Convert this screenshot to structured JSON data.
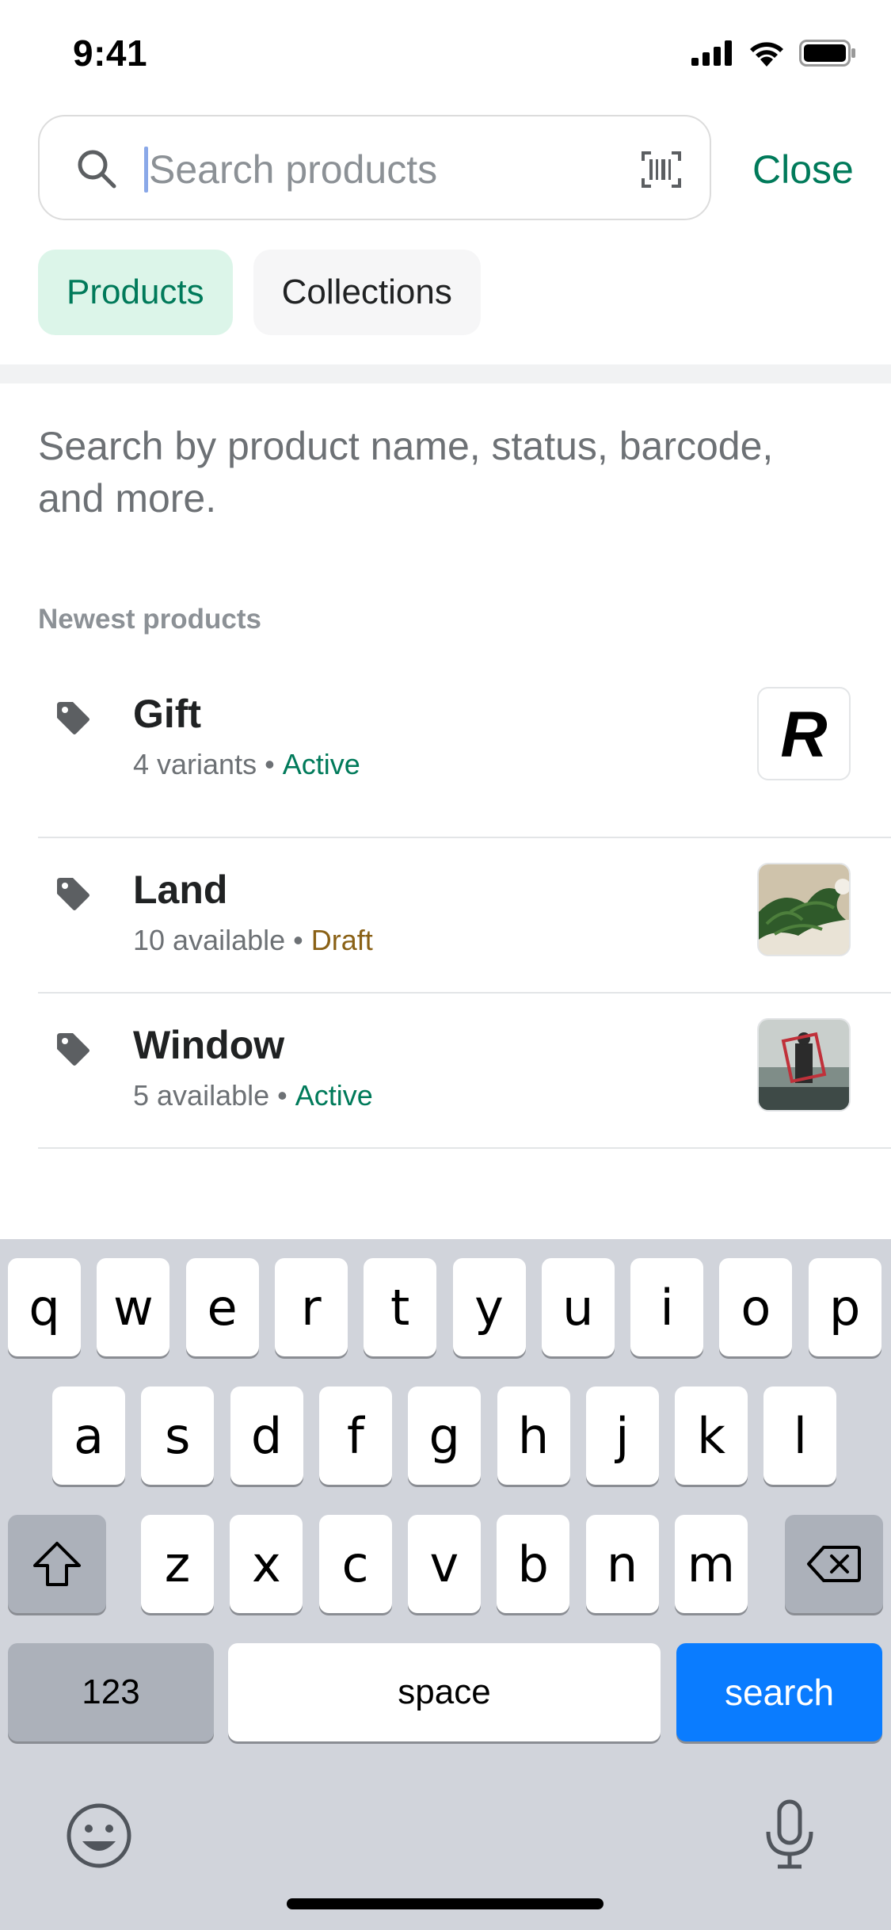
{
  "status_bar": {
    "time": "9:41"
  },
  "search": {
    "placeholder": "Search products",
    "value": "",
    "close_label": "Close"
  },
  "tabs": [
    {
      "label": "Products",
      "selected": true
    },
    {
      "label": "Collections",
      "selected": false
    }
  ],
  "hint_text": "Search by product name, status, barcode, and more.",
  "section_title": "Newest products",
  "products": [
    {
      "name": "Gift",
      "meta": "4 variants",
      "status": "Active",
      "status_color": "#007a5a",
      "thumbnail": "R"
    },
    {
      "name": "Land",
      "meta": "10 available",
      "status": "Draft",
      "status_color": "#8a6116",
      "thumbnail": "plant-photo"
    },
    {
      "name": "Window",
      "meta": "5 available",
      "status": "Active",
      "status_color": "#007a5a",
      "thumbnail": "person-in-water-photo"
    }
  ],
  "keyboard": {
    "row1": [
      "q",
      "w",
      "e",
      "r",
      "t",
      "y",
      "u",
      "i",
      "o",
      "p"
    ],
    "row2": [
      "a",
      "s",
      "d",
      "f",
      "g",
      "h",
      "j",
      "k",
      "l"
    ],
    "row3": [
      "z",
      "x",
      "c",
      "v",
      "b",
      "n",
      "m"
    ],
    "numbers_label": "123",
    "space_label": "space",
    "search_label": "search"
  },
  "colors": {
    "accent": "#007a5a",
    "chip_active_bg": "#dcf5e9",
    "keyboard_search": "#0a7cff"
  }
}
